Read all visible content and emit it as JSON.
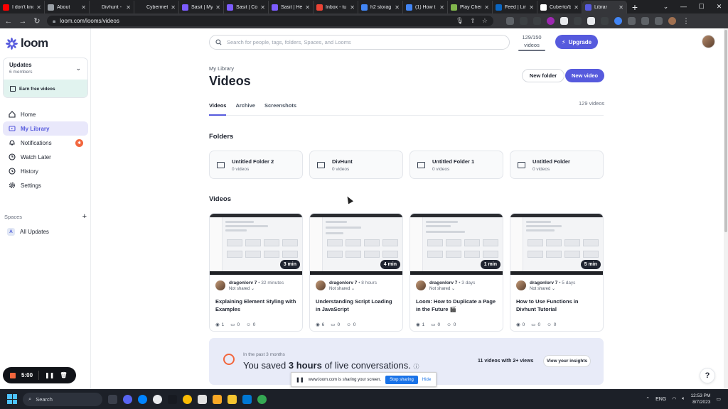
{
  "browser": {
    "tabs": [
      {
        "label": "I don't kno",
        "color": "#ff0000"
      },
      {
        "label": "About",
        "color": "#9aa0a6"
      },
      {
        "label": "Divhunt -",
        "color": "#202124"
      },
      {
        "label": "Cybermeta",
        "color": "#202124"
      },
      {
        "label": "Sasit | My",
        "color": "#7c5cff"
      },
      {
        "label": "Sasit | Cor",
        "color": "#7c5cff"
      },
      {
        "label": "Sasit | He",
        "color": "#7c5cff"
      },
      {
        "label": "Inbox - tu",
        "color": "#ea4335"
      },
      {
        "label": "h2 storag",
        "color": "#4285f4"
      },
      {
        "label": "(1) How t",
        "color": "#4285f4"
      },
      {
        "label": "Play Cher",
        "color": "#81b64c"
      },
      {
        "label": "Feed | Lin",
        "color": "#0a66c2"
      },
      {
        "label": "Cuberto/b",
        "color": "#ffffff"
      },
      {
        "label": "Librar",
        "color": "#565add"
      }
    ],
    "url": "loom.com/looms/videos"
  },
  "sidebar": {
    "logo_text": "loom",
    "workspace": {
      "name": "Updates",
      "members": "6 members",
      "earn": "Earn free videos"
    },
    "nav": [
      {
        "label": "Home",
        "icon": "home-icon"
      },
      {
        "label": "My Library",
        "icon": "library-icon",
        "active": true
      },
      {
        "label": "Notifications",
        "icon": "bell-icon"
      },
      {
        "label": "Watch Later",
        "icon": "clock-icon"
      },
      {
        "label": "History",
        "icon": "history-icon"
      },
      {
        "label": "Settings",
        "icon": "gear-icon"
      }
    ],
    "spaces_title": "Spaces",
    "space_item": {
      "badge": "A",
      "label": "All Updates"
    }
  },
  "recorder": {
    "time": "5:00"
  },
  "header": {
    "search_placeholder": "Search for people, tags, folders, Spaces, and Looms",
    "video_count_top": "129/150",
    "video_count_bottom": "videos",
    "upgrade_label": "Upgrade"
  },
  "page": {
    "breadcrumb": "My Library",
    "title": "Videos",
    "new_folder": "New folder",
    "new_video": "New video",
    "tabs": [
      "Videos",
      "Archive",
      "Screenshots"
    ],
    "tab_count": "129 videos",
    "folders_title": "Folders",
    "videos_title": "Videos"
  },
  "folders": [
    {
      "name": "Untitled Folder 2",
      "count": "0 videos"
    },
    {
      "name": "DivHunt",
      "count": "0 videos"
    },
    {
      "name": "Untitled Folder 1",
      "count": "0 videos"
    },
    {
      "name": "Untitled Folder",
      "count": "0 videos"
    }
  ],
  "videos": [
    {
      "duration": "3 min",
      "author": "dragonlorv 7",
      "ago": "32 minutes",
      "shared": "Not shared",
      "title": "Explaining Element Styling with Examples",
      "views": "1",
      "comments": "0",
      "reactions": "0"
    },
    {
      "duration": "4 min",
      "author": "dragonlorv 7",
      "ago": "8 hours",
      "shared": "Not shared",
      "title": "Understanding Script Loading in JavaScript",
      "views": "6",
      "comments": "0",
      "reactions": "0"
    },
    {
      "duration": "1 min",
      "author": "dragonlorv 7",
      "ago": "3 days",
      "shared": "Not shared",
      "title": "Loom: How to Duplicate a Page in the Future 🎬",
      "views": "1",
      "comments": "0",
      "reactions": "0"
    },
    {
      "duration": "5 min",
      "author": "dragonlorv 7",
      "ago": "5 days",
      "shared": "Not shared",
      "title": "How to Use Functions in Divhunt Tutorial",
      "views": "0",
      "comments": "0",
      "reactions": "0"
    }
  ],
  "insights": {
    "subtitle": "In the past 3 months",
    "main_prefix": "You saved ",
    "main_bold": "3 hours",
    "main_suffix": " of live conversations.",
    "count": "11 videos with 2+ views",
    "button": "View your insights"
  },
  "share_banner": {
    "text": "www.loom.com is sharing your screen.",
    "stop": "Stop sharing",
    "hide": "Hide"
  },
  "taskbar": {
    "search": "Search",
    "lang": "ENG",
    "time": "12:53 PM",
    "date": "8/7/2023"
  },
  "colors": {
    "accent": "#565add",
    "orange": "#f2663d",
    "teal": "#e1f3ef"
  }
}
